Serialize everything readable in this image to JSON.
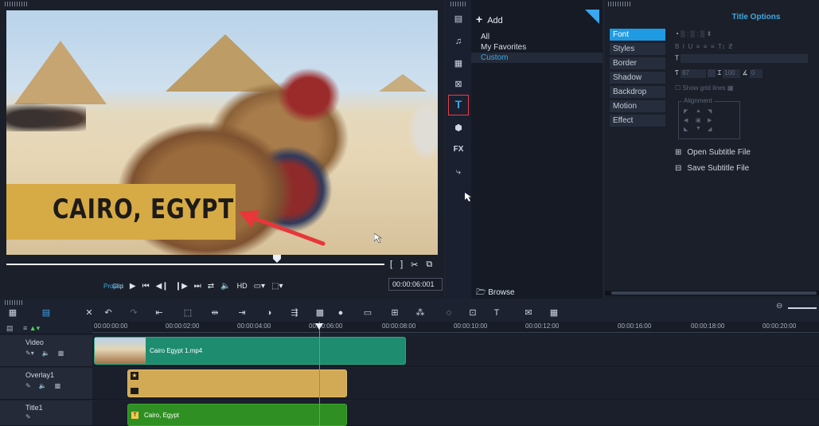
{
  "preview": {
    "overlay_text": "CAIRO, EGYPT",
    "mode_project": "Project",
    "mode_clip": "Clip",
    "hd_label": "HD",
    "timecode": "00:00:06:001",
    "mark_in": "[",
    "mark_out": "]"
  },
  "library": {
    "add_label": "Add",
    "items": [
      "All",
      "My Favorites",
      "Custom"
    ],
    "browse_label": "Browse",
    "side_icons": [
      "media-icon",
      "audio-icon",
      "instant-project-icon",
      "transition-icon",
      "title-icon",
      "graphics-icon",
      "fx-icon",
      "path-icon"
    ],
    "fx_label": "FX",
    "title_icon_label": "T"
  },
  "options": {
    "title": "Title Options",
    "tabs": [
      "Font",
      "Styles",
      "Border",
      "Shadow",
      "Backdrop",
      "Motion",
      "Effect"
    ],
    "active_tab": "Font",
    "font_size": "87",
    "line_spacing": "100",
    "angle": "0",
    "show_grid_lines": "Show grid lines",
    "alignment": "Alignment",
    "open_subtitle": "Open Subtitle File",
    "save_subtitle": "Save Subtitle File"
  },
  "timeline": {
    "ruler_labels": [
      "00:00:00:00",
      "00:00:02:00",
      "00:00:04:00",
      "00:00:06:00",
      "00:00:08:00",
      "00:00:10:00",
      "00:00:12:00",
      "00:00:16:00",
      "00:00:18:00",
      "00:00:20:00"
    ],
    "tracks": [
      {
        "name": "Video",
        "clip": "Cairo Egypt 1.mp4"
      },
      {
        "name": "Overlay1",
        "clip": ""
      },
      {
        "name": "Title1",
        "clip": "Cairo, Egypt"
      }
    ]
  },
  "colors": {
    "accent": "#3ba6ee",
    "video_clip": "#1e8c6f",
    "overlay_clip": "#d2aa55",
    "title_clip": "#2f8f22",
    "banner": "#d6aa45",
    "highlight_border": "#e84040"
  }
}
